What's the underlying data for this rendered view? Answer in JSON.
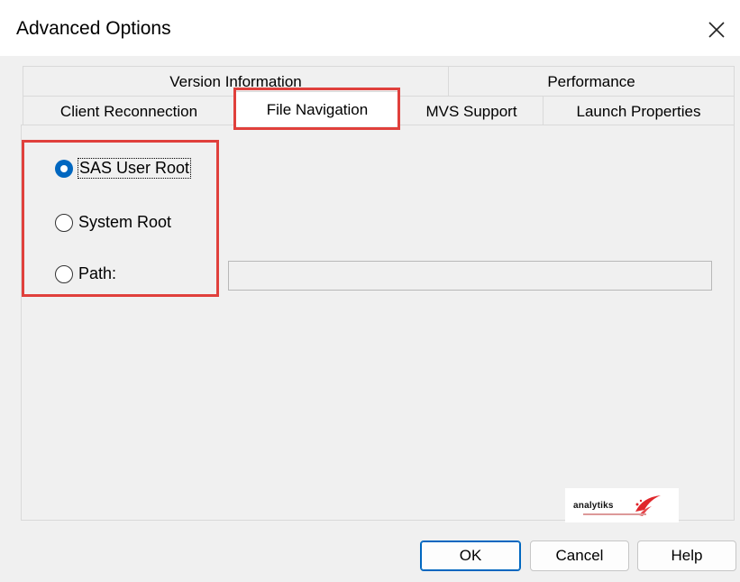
{
  "window": {
    "title": "Advanced Options",
    "close_label": "close"
  },
  "tabs": {
    "row_back": [
      {
        "label": "Version Information"
      },
      {
        "label": "Performance"
      }
    ],
    "row_front": [
      {
        "label": "Client Reconnection"
      },
      {
        "label": "File Navigation",
        "selected": true
      },
      {
        "label": "MVS Support"
      },
      {
        "label": "Launch Properties"
      }
    ]
  },
  "file_navigation": {
    "options": [
      {
        "label": "SAS User Root",
        "checked": true
      },
      {
        "label": "System Root",
        "checked": false
      },
      {
        "label": "Path:",
        "checked": false
      }
    ],
    "path_value": ""
  },
  "watermark": {
    "text": "analytiks"
  },
  "buttons": {
    "ok": "OK",
    "cancel": "Cancel",
    "help": "Help"
  },
  "colors": {
    "highlight": "#e0403c",
    "accent": "#0067c0",
    "logo_red": "#e0262b"
  }
}
